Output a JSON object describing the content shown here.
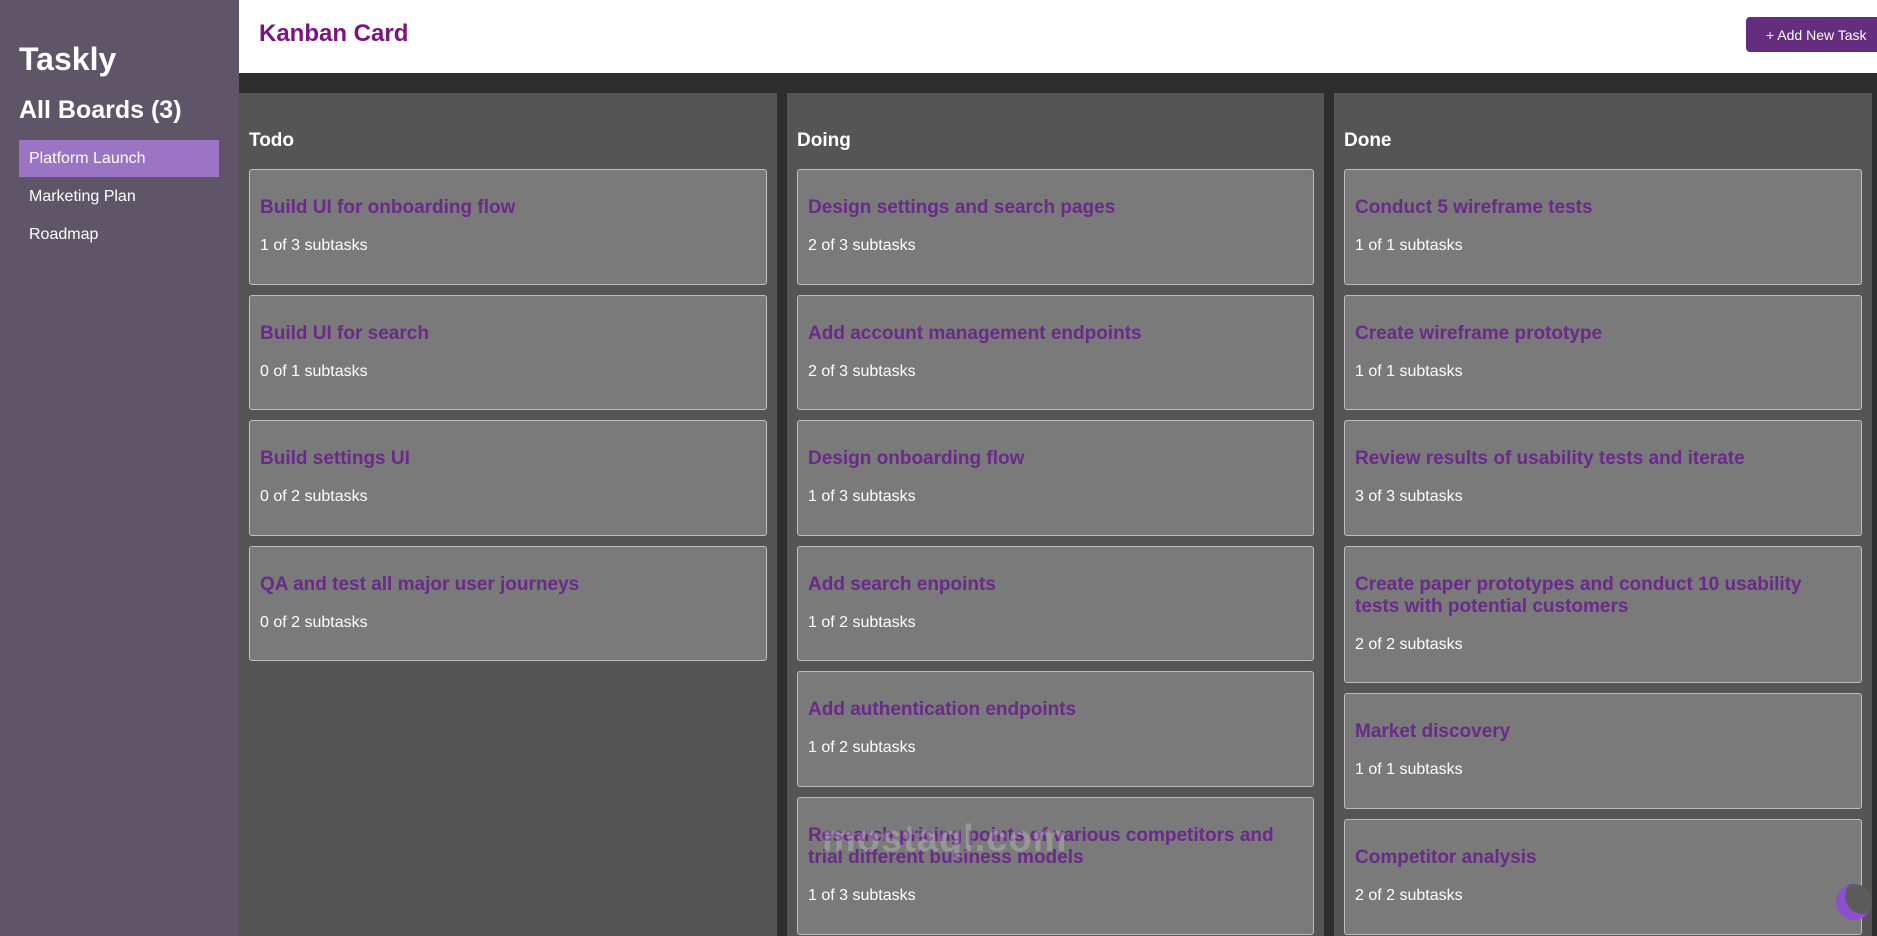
{
  "sidebar": {
    "brand": "Taskly",
    "boards_title": "All Boards (3)",
    "boards": [
      "Platform Launch",
      "Marketing Plan",
      "Roadmap"
    ],
    "active_board": "Platform Launch"
  },
  "header": {
    "title": "Kanban Card",
    "add_button": "+ Add New Task"
  },
  "columns": [
    {
      "title": "Todo",
      "cards": [
        {
          "title": "Build UI for onboarding flow",
          "subtasks": "1 of 3 subtasks"
        },
        {
          "title": "Build UI for search",
          "subtasks": "0 of 1 subtasks"
        },
        {
          "title": "Build settings UI",
          "subtasks": "0 of 2 subtasks"
        },
        {
          "title": "QA and test all major user journeys",
          "subtasks": "0 of 2 subtasks"
        }
      ]
    },
    {
      "title": "Doing",
      "cards": [
        {
          "title": "Design settings and search pages",
          "subtasks": "2 of 3 subtasks"
        },
        {
          "title": "Add account management endpoints",
          "subtasks": "2 of 3 subtasks"
        },
        {
          "title": "Design onboarding flow",
          "subtasks": "1 of 3 subtasks"
        },
        {
          "title": "Add search enpoints",
          "subtasks": "1 of 2 subtasks"
        },
        {
          "title": "Add authentication endpoints",
          "subtasks": "1 of 2 subtasks"
        },
        {
          "title": "Research pricing points of various competitors and trial different business models",
          "subtasks": "1 of 3 subtasks"
        }
      ]
    },
    {
      "title": "Done",
      "cards": [
        {
          "title": "Conduct 5 wireframe tests",
          "subtasks": "1 of 1 subtasks"
        },
        {
          "title": "Create wireframe prototype",
          "subtasks": "1 of 1 subtasks"
        },
        {
          "title": "Review results of usability tests and iterate",
          "subtasks": "3 of 3 subtasks"
        },
        {
          "title": "Create paper prototypes and conduct 10 usability tests with potential customers",
          "subtasks": "2 of 2 subtasks"
        },
        {
          "title": "Market discovery",
          "subtasks": "1 of 1 subtasks"
        },
        {
          "title": "Competitor analysis",
          "subtasks": "2 of 2 subtasks"
        }
      ]
    }
  ],
  "watermark": "mostaql.com",
  "theme_toggle_icon": "moon-icon"
}
